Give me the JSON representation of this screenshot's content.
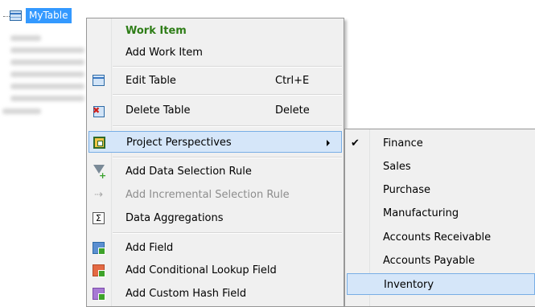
{
  "tree": {
    "root_label": "MyTable"
  },
  "context_menu": {
    "items": [
      {
        "label": "Work Item",
        "type": "header"
      },
      {
        "label": "Add Work Item"
      },
      {
        "label": "Edit Table",
        "shortcut": "Ctrl+E",
        "icon": "table-icon"
      },
      {
        "label": "Delete Table",
        "shortcut": "Delete",
        "icon": "delete-table-icon"
      },
      {
        "label": "Project Perspectives",
        "icon": "perspectives-icon",
        "highlighted": true,
        "has_submenu": true
      },
      {
        "label": "Add Data Selection Rule",
        "icon": "filter-add-icon"
      },
      {
        "label": "Add Incremental Selection Rule",
        "icon": "incremental-rule-icon",
        "disabled": true
      },
      {
        "label": "Data Aggregations",
        "icon": "sigma-icon"
      },
      {
        "label": "Add Field",
        "icon": "add-field-icon"
      },
      {
        "label": "Add Conditional Lookup Field",
        "icon": "add-lookup-field-icon"
      },
      {
        "label": "Add Custom Hash Field",
        "icon": "add-hash-field-icon"
      }
    ]
  },
  "submenu": {
    "items": [
      {
        "label": "Finance",
        "checked": true
      },
      {
        "label": "Sales"
      },
      {
        "label": "Purchase"
      },
      {
        "label": "Manufacturing"
      },
      {
        "label": "Accounts Receivable"
      },
      {
        "label": "Accounts Payable"
      },
      {
        "label": "Inventory",
        "highlighted": true
      }
    ]
  },
  "colors": {
    "selection": "#3399ff",
    "menu_background": "#f0f0f0",
    "highlight_fill": "#d5e6f9",
    "highlight_border": "#78aee5",
    "header_text": "#2e7d17",
    "disabled_text": "#8d8d8d"
  }
}
